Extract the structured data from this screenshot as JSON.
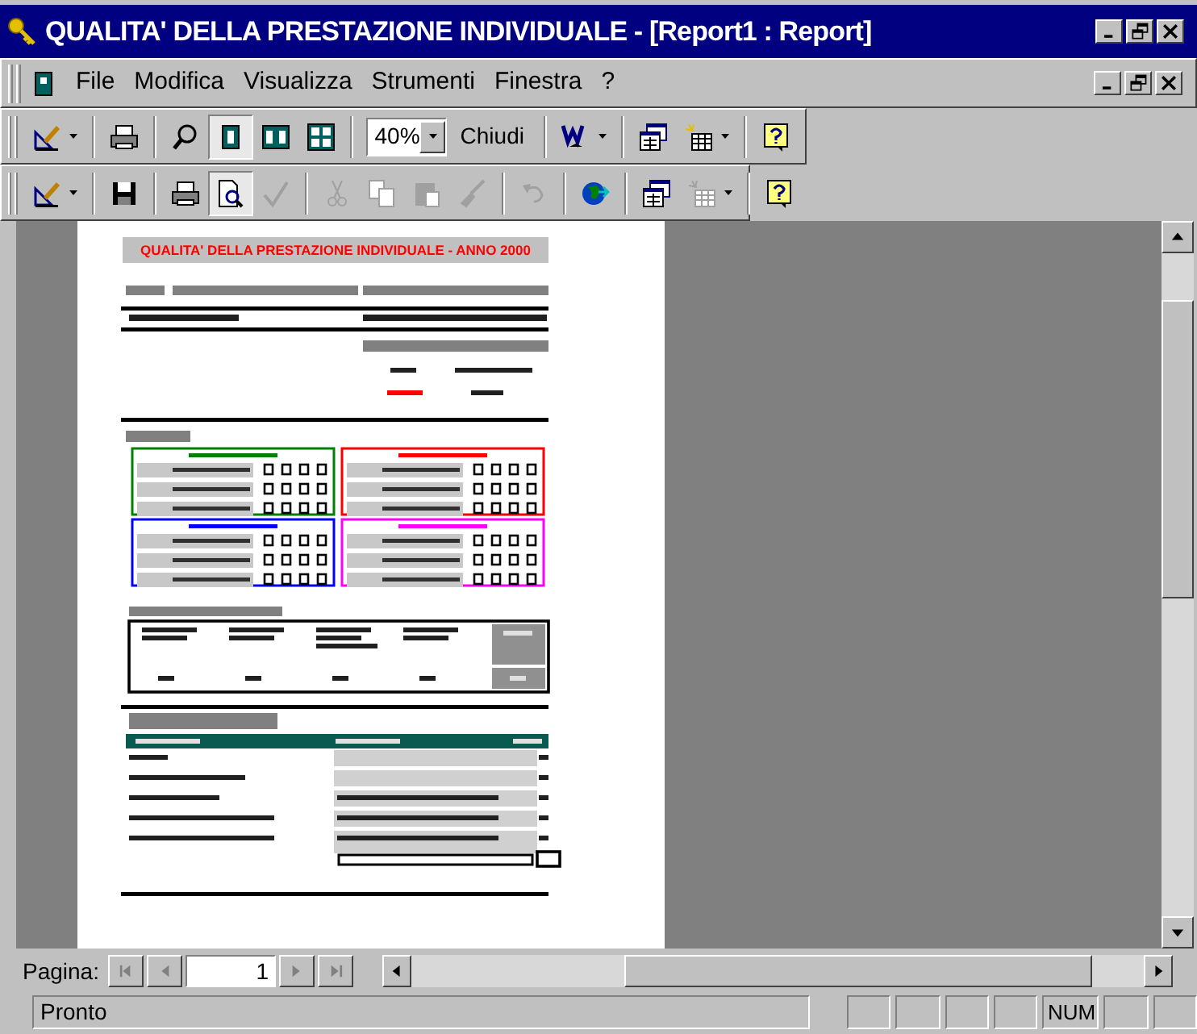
{
  "window": {
    "title": "QUALITA' DELLA PRESTAZIONE INDIVIDUALE - [Report1 : Report]"
  },
  "menu": [
    "File",
    "Modifica",
    "Visualizza",
    "Strumenti",
    "Finestra",
    "?"
  ],
  "toolbar_1": [
    {
      "kind": "icon",
      "dropdown": true,
      "selected": false,
      "disabled": false
    },
    {
      "kind": "sep"
    },
    {
      "kind": "icon",
      "dropdown": false,
      "selected": false,
      "disabled": false
    },
    {
      "kind": "sep"
    },
    {
      "kind": "icon",
      "dropdown": false,
      "selected": false,
      "disabled": false
    },
    {
      "kind": "icon",
      "dropdown": false,
      "selected": true,
      "disabled": false
    },
    {
      "kind": "icon",
      "dropdown": false,
      "selected": false,
      "disabled": false
    },
    {
      "kind": "icon",
      "dropdown": false,
      "selected": false,
      "disabled": false
    },
    {
      "kind": "sep"
    },
    {
      "kind": "combo",
      "value": "40%"
    },
    {
      "kind": "text",
      "label": "Chiudi"
    },
    {
      "kind": "sep"
    },
    {
      "kind": "icon",
      "dropdown": true,
      "selected": false,
      "disabled": false
    },
    {
      "kind": "sep"
    },
    {
      "kind": "icon",
      "dropdown": false,
      "selected": false,
      "disabled": false
    },
    {
      "kind": "icon",
      "dropdown": true,
      "selected": false,
      "disabled": false
    },
    {
      "kind": "sep"
    },
    {
      "kind": "icon",
      "dropdown": false,
      "selected": false,
      "disabled": false
    }
  ],
  "toolbar_2": [
    {
      "kind": "icon",
      "dropdown": true,
      "selected": false,
      "disabled": false
    },
    {
      "kind": "sep"
    },
    {
      "kind": "icon",
      "dropdown": false,
      "selected": false,
      "disabled": false
    },
    {
      "kind": "sep"
    },
    {
      "kind": "icon",
      "dropdown": false,
      "selected": false,
      "disabled": false
    },
    {
      "kind": "icon",
      "dropdown": false,
      "selected": true,
      "disabled": false
    },
    {
      "kind": "icon",
      "dropdown": false,
      "selected": false,
      "disabled": true
    },
    {
      "kind": "sep"
    },
    {
      "kind": "icon",
      "dropdown": false,
      "selected": false,
      "disabled": true
    },
    {
      "kind": "icon",
      "dropdown": false,
      "selected": false,
      "disabled": true
    },
    {
      "kind": "icon",
      "dropdown": false,
      "selected": false,
      "disabled": true
    },
    {
      "kind": "icon",
      "dropdown": false,
      "selected": false,
      "disabled": true
    },
    {
      "kind": "sep"
    },
    {
      "kind": "icon",
      "dropdown": false,
      "selected": false,
      "disabled": true
    },
    {
      "kind": "sep"
    },
    {
      "kind": "icon",
      "dropdown": false,
      "selected": false,
      "disabled": false
    },
    {
      "kind": "sep"
    },
    {
      "kind": "icon",
      "dropdown": false,
      "selected": false,
      "disabled": false
    },
    {
      "kind": "icon",
      "dropdown": true,
      "selected": false,
      "disabled": true
    },
    {
      "kind": "sep"
    },
    {
      "kind": "icon",
      "dropdown": false,
      "selected": false,
      "disabled": false
    }
  ],
  "report": {
    "title": "QUALITA' DELLA PRESTAZIONE INDIVIDUALE - ANNO 2000"
  },
  "page_nav": {
    "label": "Pagina:",
    "page": "1"
  },
  "status_bar": {
    "text": "Pronto",
    "indicators": [
      {
        "kind": "empty"
      },
      {
        "kind": "empty"
      },
      {
        "kind": "empty"
      },
      {
        "kind": "empty"
      },
      {
        "kind": "text",
        "label": "NUM"
      },
      {
        "kind": "empty"
      },
      {
        "kind": "empty"
      }
    ]
  }
}
